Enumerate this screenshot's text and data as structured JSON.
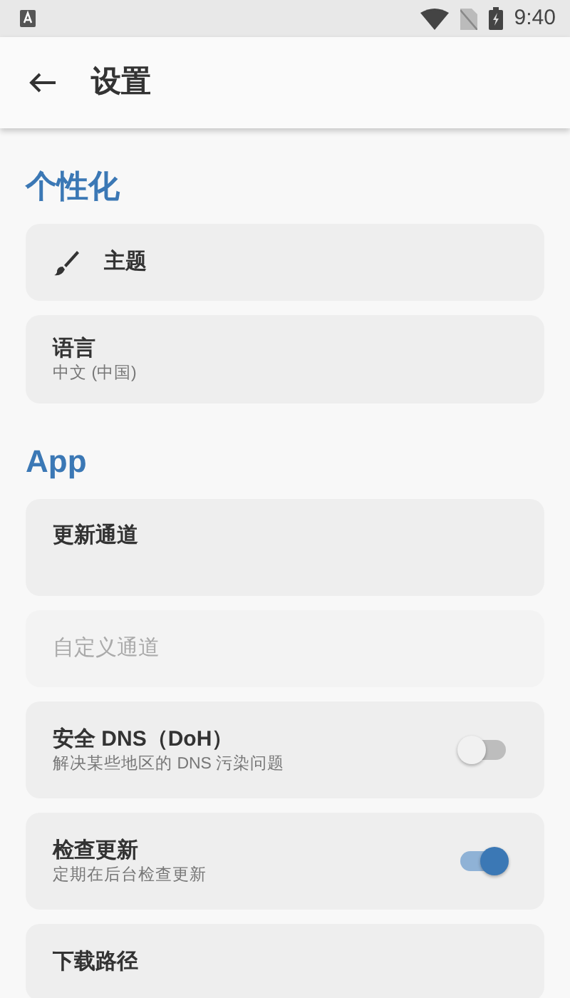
{
  "status_bar": {
    "time": "9:40"
  },
  "app_bar": {
    "title": "设置"
  },
  "sections": [
    {
      "title": "个性化",
      "items": [
        {
          "kind": "action",
          "title": "主题",
          "disabled": false
        },
        {
          "kind": "value",
          "title": "语言",
          "subtitle": "中文 (中国)",
          "disabled": false
        }
      ]
    },
    {
      "title": "App",
      "items": [
        {
          "kind": "tall",
          "title": "更新通道",
          "disabled": false
        },
        {
          "kind": "value",
          "title": "自定义通道",
          "disabled": true
        },
        {
          "kind": "switch",
          "title": "安全 DNS（DoH）",
          "subtitle": "解决某些地区的 DNS 污染问题",
          "on": false,
          "disabled": false
        },
        {
          "kind": "switch",
          "title": "检查更新",
          "subtitle": "定期在后台检查更新",
          "on": true,
          "disabled": false
        },
        {
          "kind": "value",
          "title": "下载路径",
          "disabled": false
        }
      ]
    }
  ]
}
